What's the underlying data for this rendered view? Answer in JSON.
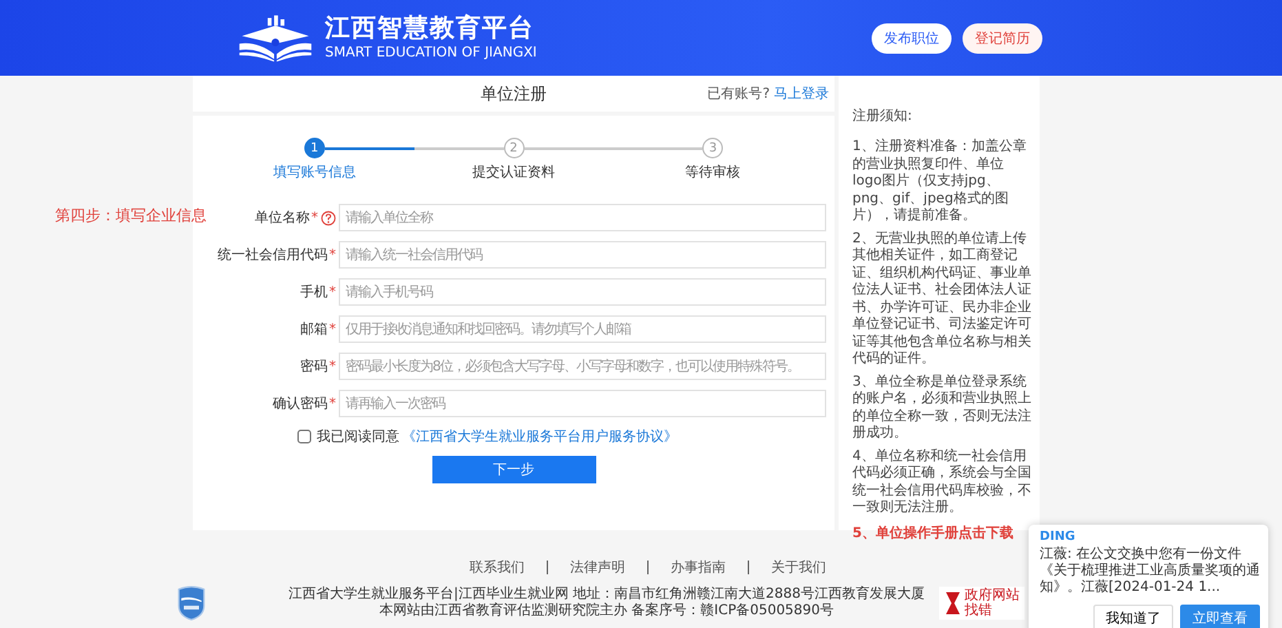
{
  "header": {
    "title": "江西智慧教育平台",
    "subtitle": "SMART EDUCATION OF JIANGXI",
    "buttons": [
      {
        "label": "发布职位",
        "kind": "primary"
      },
      {
        "label": "登记简历",
        "kind": "danger"
      }
    ]
  },
  "annotation": "第四步：填写企业信息",
  "form": {
    "title": "单位注册",
    "login_prompt": "已有账号?",
    "login_link": "马上登录",
    "steps": [
      {
        "number": "1",
        "label": "填写账号信息",
        "selected": true
      },
      {
        "number": "2",
        "label": "提交认证资料",
        "selected": false
      },
      {
        "number": "3",
        "label": "等待审核",
        "selected": false
      }
    ],
    "fields": [
      {
        "label": "单位名称",
        "required_mark": "*",
        "help_icon": true,
        "placeholder": "请输入单位全称"
      },
      {
        "label": "统一社会信用代码",
        "required_mark": "*",
        "help_icon": false,
        "placeholder": "请输入统一社会信用代码"
      },
      {
        "label": "手机",
        "required_mark": "*",
        "help_icon": false,
        "placeholder": "请输入手机号码"
      },
      {
        "label": "邮箱",
        "required_mark": "*",
        "help_icon": false,
        "placeholder": "仅用于接收消息通知和找回密码。请勿填写个人邮箱"
      },
      {
        "label": "密码",
        "required_mark": "*",
        "help_icon": false,
        "placeholder": "密码最小长度为8位，必须包含大写字母、小写字母和数字，也可以使用特殊符号。"
      },
      {
        "label": "确认密码",
        "required_mark": "*",
        "help_icon": false,
        "placeholder": "请再输入一次密码"
      }
    ],
    "agreement": {
      "checked": false,
      "text": "我已阅读同意",
      "link": "《江西省大学生就业服务平台用户服务协议》"
    },
    "submit": "下一步"
  },
  "notice": {
    "title": "注册须知:",
    "items": [
      {
        "kind": "text",
        "text": "1、注册资料准备：加盖公章的营业执照复印件、单位logo图片（仅支持jpg、png、gif、jpeg格式的图片），请提前准备。"
      },
      {
        "kind": "text",
        "text": "2、无营业执照的单位请上传其他相关证件，如工商登记证、组织机构代码证、事业单位法人证书、社会团体法人证书、办学许可证、民办非企业单位登记证书、司法鉴定许可证等其他包含单位名称与相关代码的证件。"
      },
      {
        "kind": "text",
        "text": "3、单位全称是单位登录系统的账户名，必须和营业执照上的单位全称一致，否则无法注册成功。"
      },
      {
        "kind": "text",
        "text": "4、单位名称和统一社会信用代码必须正确，系统会与全国统一社会信用代码库校验，不一致则无法注册。"
      },
      {
        "kind": "link",
        "text": "5、单位操作手册点击下载"
      }
    ]
  },
  "footer": {
    "links": [
      "联系我们",
      "法律声明",
      "办事指南",
      "关于我们"
    ],
    "address": "江西省大学生就业服务平台|江西毕业生就业网 地址：南昌市红角洲赣江南大道2888号江西教育发展大厦",
    "record": "本网站由江西省教育评估监测研究院主办  备案序号：赣ICP备05005890号",
    "gov_badge": {
      "title": "政府网站",
      "subtitle": "找错"
    }
  },
  "notification": {
    "app": "DING",
    "message": "江薇: 在公文交换中您有一份文件《关于梳理推进工业高质量奖项的通知》。江薇[2024-01-24 1...",
    "buttons": [
      {
        "label": "我知道了",
        "kind": "plain"
      },
      {
        "label": "立即查看",
        "kind": "primary"
      }
    ]
  }
}
